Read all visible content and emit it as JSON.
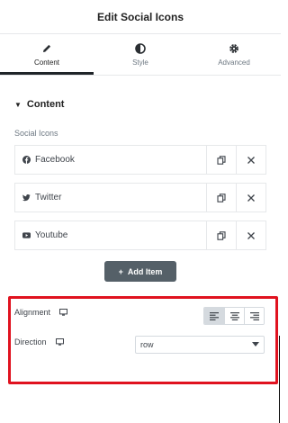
{
  "header": {
    "title": "Edit Social Icons"
  },
  "tabs": [
    {
      "label": "Content",
      "icon": "pencil-icon",
      "active": true
    },
    {
      "label": "Style",
      "icon": "half-circle-icon",
      "active": false
    },
    {
      "label": "Advanced",
      "icon": "gear-icon",
      "active": false
    }
  ],
  "content_section": {
    "title": "Content"
  },
  "social_icons": {
    "label": "Social Icons",
    "items": [
      {
        "label": "Facebook",
        "icon": "facebook-icon"
      },
      {
        "label": "Twitter",
        "icon": "twitter-icon"
      },
      {
        "label": "Youtube",
        "icon": "youtube-icon"
      }
    ],
    "add_label": "Add Item"
  },
  "alignment": {
    "label": "Alignment",
    "selected": "left",
    "options": [
      "left",
      "center",
      "right"
    ]
  },
  "direction": {
    "label": "Direction",
    "value": "row"
  },
  "colors": {
    "highlight": "#e0121f",
    "add_button": "#556068",
    "active_tab_border": "#1f2428"
  }
}
